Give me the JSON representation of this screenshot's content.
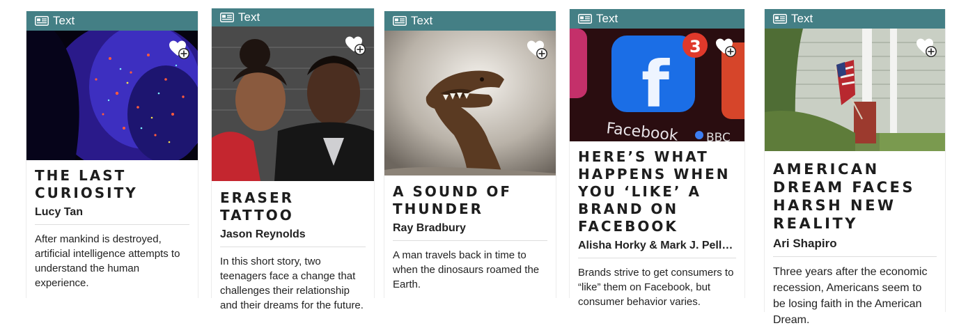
{
  "colors": {
    "header": "#447f85",
    "title": "#1d1d1d",
    "divider": "#dddddd"
  },
  "cards": [
    {
      "type_label": "Text",
      "type_icon": "newspaper-icon",
      "title": "THE LAST CURIOSITY",
      "author": "Lucy Tan",
      "description": "After mankind is destroyed, artificial intelligence attempts to understand the human experience."
    },
    {
      "type_label": "Text",
      "type_icon": "newspaper-icon",
      "title": "ERASER TATTOO",
      "author": "Jason Reynolds",
      "description": "In this short story, two teenagers face a change that challenges their relationship and their dreams for the future."
    },
    {
      "type_label": "Text",
      "type_icon": "newspaper-icon",
      "title": "A SOUND OF THUNDER",
      "author": "Ray Bradbury",
      "description": "A man travels back in time to when the dinosaurs roamed the Earth."
    },
    {
      "type_label": "Text",
      "type_icon": "newspaper-icon",
      "title": "HERE’S WHAT HAPPENS WHEN YOU ‘LIKE’ A BRAND ON FACEBOOK",
      "author": "Alisha Horky & Mark J. Pelle...",
      "description": "Brands strive to get consumers to “like” them on Facebook, but consumer behavior varies.",
      "image_text": {
        "app_name": "Facebook",
        "badge": "3",
        "watermark": "BBC",
        "logo_letter": "f"
      }
    },
    {
      "type_label": "Text",
      "type_icon": "newspaper-icon",
      "title": "AMERICAN DREAM FACES HARSH NEW REALITY",
      "author": "Ari Shapiro",
      "description": "Three years after the economic recession, Americans seem to be losing faith in the American Dream."
    }
  ]
}
